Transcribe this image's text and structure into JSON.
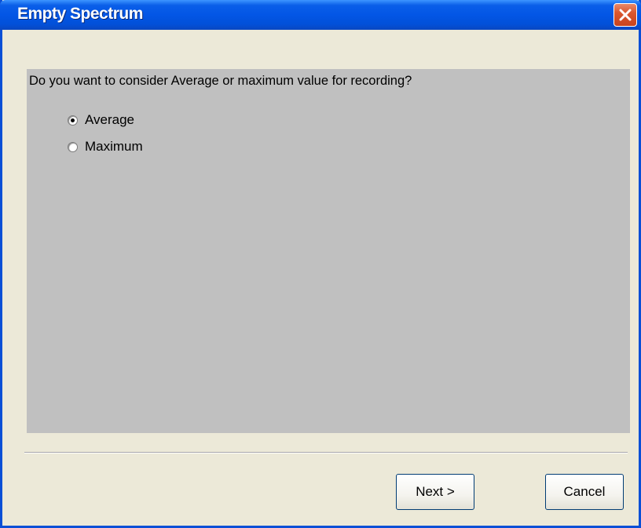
{
  "window": {
    "title": "Empty Spectrum",
    "close_icon": "close-icon"
  },
  "content": {
    "question": "Do you want to consider Average or maximum value for recording?",
    "options": [
      {
        "label": "Average",
        "selected": true
      },
      {
        "label": "Maximum",
        "selected": false
      }
    ]
  },
  "buttons": {
    "next_label": "Next >",
    "cancel_label": "Cancel"
  },
  "colors": {
    "titlebar": "#0356e6",
    "panel": "#c0c0c0",
    "dialog_bg": "#ece9d8",
    "close_button": "#d9572f"
  }
}
